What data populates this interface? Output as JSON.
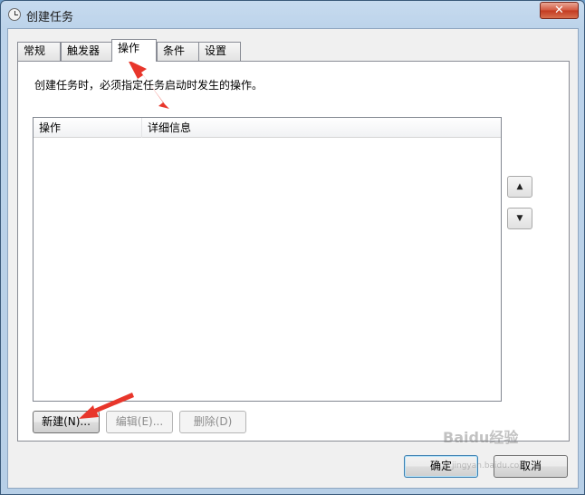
{
  "window": {
    "title": "创建任务",
    "close_glyph": "✕"
  },
  "tabs": [
    {
      "label": "常规",
      "active": false
    },
    {
      "label": "触发器",
      "active": false
    },
    {
      "label": "操作",
      "active": true
    },
    {
      "label": "条件",
      "active": false
    },
    {
      "label": "设置",
      "active": false
    }
  ],
  "panel": {
    "description": "创建任务时，必须指定任务启动时发生的操作。"
  },
  "list": {
    "columns": [
      "操作",
      "详细信息"
    ],
    "rows": []
  },
  "move": {
    "up_glyph": "▲",
    "down_glyph": "▼"
  },
  "buttons": {
    "new": "新建(N)...",
    "edit": "编辑(E)...",
    "delete": "删除(D)",
    "ok": "确定",
    "cancel": "取消"
  },
  "watermark": {
    "text": "Baidu经验",
    "sub": "jingyan.baidu.com"
  },
  "annotations": {
    "arrow_color": "#e8362b"
  }
}
